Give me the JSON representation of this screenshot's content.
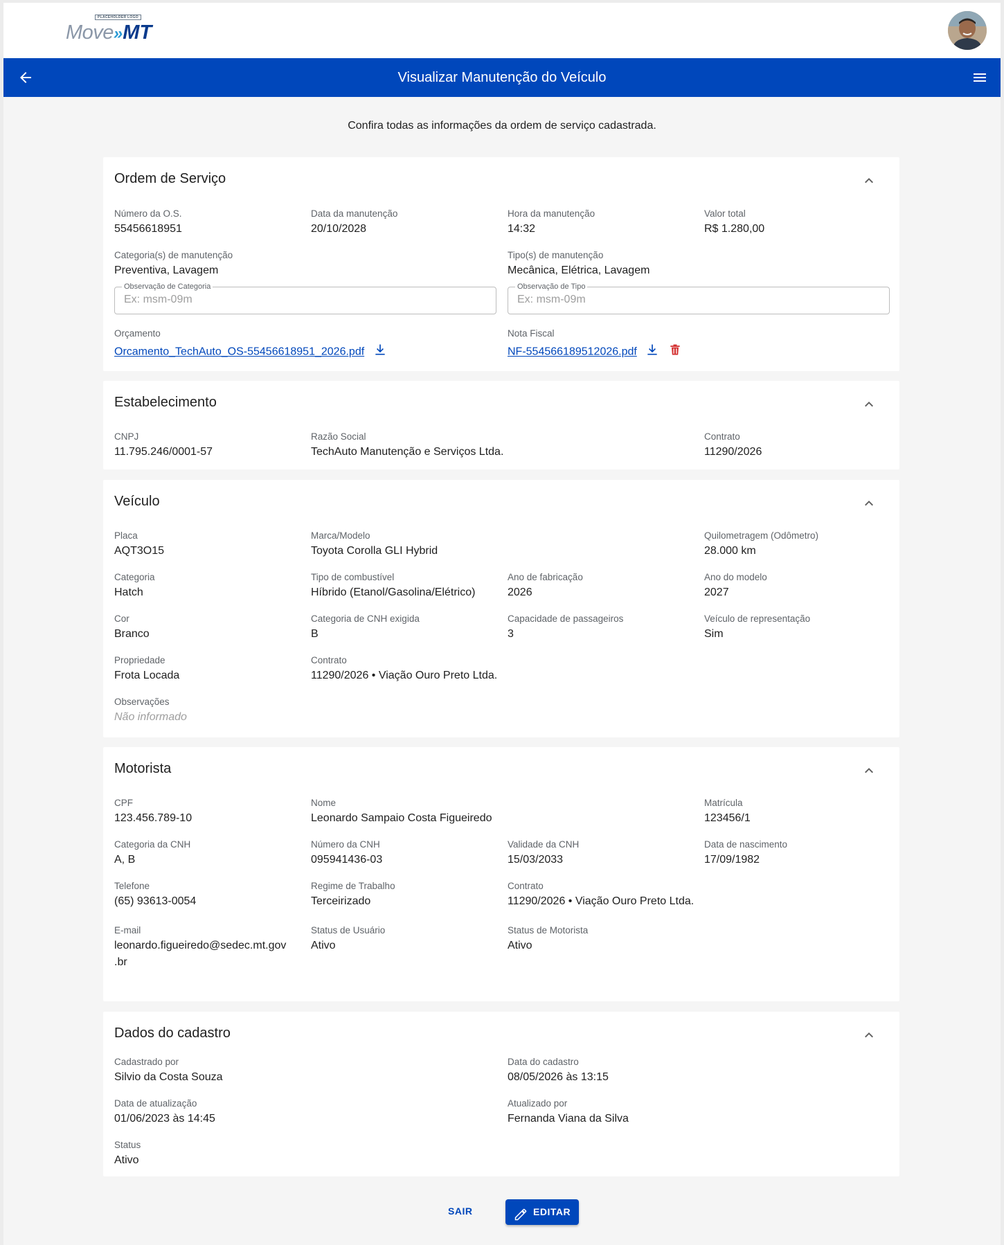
{
  "app": {
    "logo": {
      "tag": "PLACEHOLDER LOGO",
      "move": "Move",
      "arrows": "»",
      "mt": "MT"
    },
    "page_title": "Visualizar Manutenção do Veículo",
    "intro": "Confira todas as informações da ordem de serviço cadastrada."
  },
  "colors": {
    "primary": "#0047bb",
    "danger": "#d32f2f",
    "background": "#f5f5f5"
  },
  "icons": {
    "back": "arrow-left-icon",
    "menu": "hamburger-menu-icon",
    "collapse": "chevron-up-icon",
    "download": "download-icon",
    "delete": "trash-icon",
    "edit": "pencil-icon"
  },
  "ordem": {
    "title": "Ordem de Serviço",
    "numero_label": "Número da O.S.",
    "numero": "55456618951",
    "data_label": "Data da manutenção",
    "data": "20/10/2028",
    "hora_label": "Hora da manutenção",
    "hora": "14:32",
    "valor_label": "Valor total",
    "valor": "R$ 1.280,00",
    "categorias_label": "Categoria(s) de manutenção",
    "categorias": "Preventiva, Lavagem",
    "tipos_label": "Tipo(s) de manutenção",
    "tipos": "Mecânica, Elétrica, Lavagem",
    "obs_categoria_label": "Observação de Categoria",
    "obs_categoria_placeholder": "Ex: msm-09m",
    "obs_categoria_value": "",
    "obs_tipo_label": "Observação de Tipo",
    "obs_tipo_placeholder": "Ex: msm-09m",
    "obs_tipo_value": "",
    "orcamento_label": "Orçamento",
    "orcamento_file": "Orcamento_TechAuto_OS-55456618951_2026.pdf",
    "nota_label": "Nota Fiscal",
    "nota_file": "NF-554566189512026.pdf"
  },
  "estabelecimento": {
    "title": "Estabelecimento",
    "cnpj_label": "CNPJ",
    "cnpj": "11.795.246/0001-57",
    "razao_label": "Razão Social",
    "razao": "TechAuto Manutenção e Serviços Ltda.",
    "contrato_label": "Contrato",
    "contrato": "11290/2026"
  },
  "veiculo": {
    "title": "Veículo",
    "placa_label": "Placa",
    "placa": "AQT3O15",
    "marca_label": "Marca/Modelo",
    "marca": "Toyota Corolla GLI Hybrid",
    "km_label": "Quilometragem (Odômetro)",
    "km": "28.000 km",
    "categoria_label": "Categoria",
    "categoria": "Hatch",
    "combustivel_label": "Tipo de combustível",
    "combustivel": "Híbrido (Etanol/Gasolina/Elétrico)",
    "ano_fab_label": "Ano de fabricação",
    "ano_fab": "2026",
    "ano_mod_label": "Ano do modelo",
    "ano_mod": "2027",
    "cor_label": "Cor",
    "cor": "Branco",
    "cnh_cat_label": "Categoria de CNH exigida",
    "cnh_cat": "B",
    "capacidade_label": "Capacidade de passageiros",
    "capacidade": "3",
    "representacao_label": "Veículo de representação",
    "representacao": "Sim",
    "propriedade_label": "Propriedade",
    "propriedade": "Frota Locada",
    "contrato_label": "Contrato",
    "contrato": "11290/2026 • Viação Ouro Preto Ltda.",
    "obs_label": "Observações",
    "obs": "Não informado"
  },
  "motorista": {
    "title": "Motorista",
    "cpf_label": "CPF",
    "cpf": "123.456.789-10",
    "nome_label": "Nome",
    "nome": "Leonardo Sampaio Costa Figueiredo",
    "matricula_label": "Matrícula",
    "matricula": "123456/1",
    "cnh_cat_label": "Categoria da CNH",
    "cnh_cat": "A, B",
    "cnh_num_label": "Número da CNH",
    "cnh_num": "095941436-03",
    "cnh_val_label": "Validade da CNH",
    "cnh_val": "15/03/2033",
    "nasc_label": "Data de nascimento",
    "nasc": "17/09/1982",
    "tel_label": "Telefone",
    "tel": "(65) 93613-0054",
    "regime_label": "Regime de Trabalho",
    "regime": "Terceirizado",
    "contrato_label": "Contrato",
    "contrato": "11290/2026 • Viação Ouro Preto Ltda.",
    "email_label": "E-mail",
    "email_line1": "leonardo.figueiredo@sedec.mt.gov",
    "email_line2": ".br",
    "status_usuario_label": "Status de Usuário",
    "status_usuario": "Ativo",
    "status_motorista_label": "Status de Motorista",
    "status_motorista": "Ativo"
  },
  "cadastro": {
    "title": "Dados do cadastro",
    "cadastrado_por_label": "Cadastrado por",
    "cadastrado_por": "Silvio da Costa Souza",
    "data_cadastro_label": "Data do cadastro",
    "data_cadastro": "08/05/2026 às 13:15",
    "data_atualizacao_label": "Data de atualização",
    "data_atualizacao": "01/06/2023 às 14:45",
    "atualizado_por_label": "Atualizado por",
    "atualizado_por": "Fernanda Viana da Silva",
    "status_label": "Status",
    "status": "Ativo"
  },
  "actions": {
    "sair": "SAIR",
    "editar": "EDITAR"
  }
}
